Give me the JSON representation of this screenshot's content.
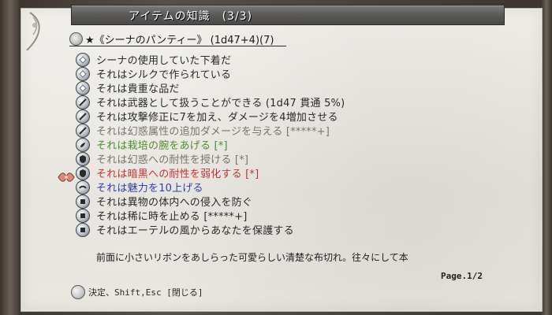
{
  "window": {
    "title": "アイテムの知識　(3/3)"
  },
  "item": {
    "heading": "★《シーナのパンティー》 (1d47+4)(7)"
  },
  "properties": [
    {
      "text": "シーナの使用していた下着だ",
      "color": "default",
      "icon": "info-icon"
    },
    {
      "text": "それはシルクで作られている",
      "color": "default",
      "icon": "info-icon"
    },
    {
      "text": "それは貴重な品だ",
      "color": "default",
      "icon": "info-icon"
    },
    {
      "text": "それは武器として扱うことができる (1d47 貫通 5%)",
      "color": "weapon",
      "icon": "sword-icon"
    },
    {
      "text": "それは攻撃修正に7を加え、ダメージを4増加させる",
      "color": "weapon",
      "icon": "sword-icon"
    },
    {
      "text": "それは幻惑属性の追加ダメージを与える [*****+]",
      "color": "gray",
      "icon": "sword-icon"
    },
    {
      "text": "それは栽培の腕をあげる [*]",
      "color": "green",
      "icon": "skill-icon"
    },
    {
      "text": "それは幻惑への耐性を授ける [*]",
      "color": "gray",
      "icon": "resist-icon"
    },
    {
      "text": "それは暗黒への耐性を弱化する [*]",
      "color": "red",
      "icon": "resist-icon"
    },
    {
      "text": "それは魅力を10上げる",
      "color": "blue",
      "icon": "attribute-icon"
    },
    {
      "text": "それは異物の体内への侵入を防ぐ",
      "color": "default",
      "icon": "enchant-icon"
    },
    {
      "text": "それは稀に時を止める [*****+]",
      "color": "default",
      "icon": "enchant-icon"
    },
    {
      "text": "それはエーテルの風からあなたを保護する",
      "color": "default",
      "icon": "enchant-icon"
    }
  ],
  "description": "前面に小さいリボンをあしらった可愛らしい清楚な布切れ。往々にして本",
  "pagination": {
    "label": "Page.1/2"
  },
  "footer": {
    "hint": "決定、Shift,Esc [閉じる]"
  },
  "colors": {
    "default": "#2a2a2a",
    "gray": "#77746f",
    "green": "#4f8d2d",
    "red": "#c23434",
    "blue": "#2f3fa8"
  }
}
